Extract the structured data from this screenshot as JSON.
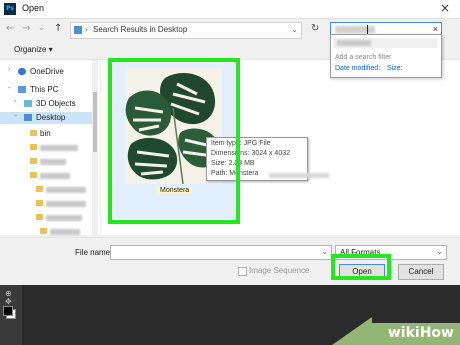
{
  "window": {
    "title": "Open",
    "app_icon": "Ps",
    "close_icon": "×"
  },
  "nav": {
    "back_icon": "←",
    "forward_icon": "→",
    "recent_icon": "⌄",
    "up_icon": "↑",
    "address_chevron": "›",
    "address": "Search Results in Desktop",
    "address_dropdown": "⌄",
    "refresh_icon": "↻",
    "search_clear": "×"
  },
  "toolbar": {
    "organize_label": "Organize ▾"
  },
  "sidebar": {
    "items": [
      {
        "label": "OneDrive",
        "icon": "cloud-icon",
        "color": "#2f79cf"
      },
      {
        "label": "This PC",
        "icon": "computer-icon",
        "color": "#5a9bd8"
      },
      {
        "label": "3D Objects",
        "icon": "cube-icon",
        "color": "#67b6e0"
      },
      {
        "label": "Desktop",
        "icon": "desktop-icon",
        "color": "#4a8fd4",
        "selected": true
      },
      {
        "label": "bin",
        "icon": "folder-icon",
        "color": "#e8c25a"
      }
    ],
    "chevron": "›"
  },
  "search_dropdown": {
    "hint": "Add a search filter",
    "filters": [
      "Date modified:",
      "Size:"
    ]
  },
  "file": {
    "name": "Monstera",
    "tooltip": {
      "type": "Item type: JPG File",
      "dimensions": "Dimensions: 3024 x 4032",
      "size": "Size: 2.03 MB",
      "path": "Path: Monstera"
    }
  },
  "bottom": {
    "filename_label": "File name:",
    "filename_value": "",
    "format": "All Formats",
    "dropdown_icon": "⌄",
    "image_sequence": "Image Sequence",
    "image_sequence_checked": false,
    "open_label": "Open",
    "cancel_label": "Cancel"
  },
  "photoshop": {
    "zoom_tool": "⊕",
    "hand_tool": "✥"
  },
  "watermark": {
    "text": "wikiHow"
  },
  "colors": {
    "highlight": "#22e822",
    "selection": "#cce4f7",
    "accent": "#0066cc"
  }
}
